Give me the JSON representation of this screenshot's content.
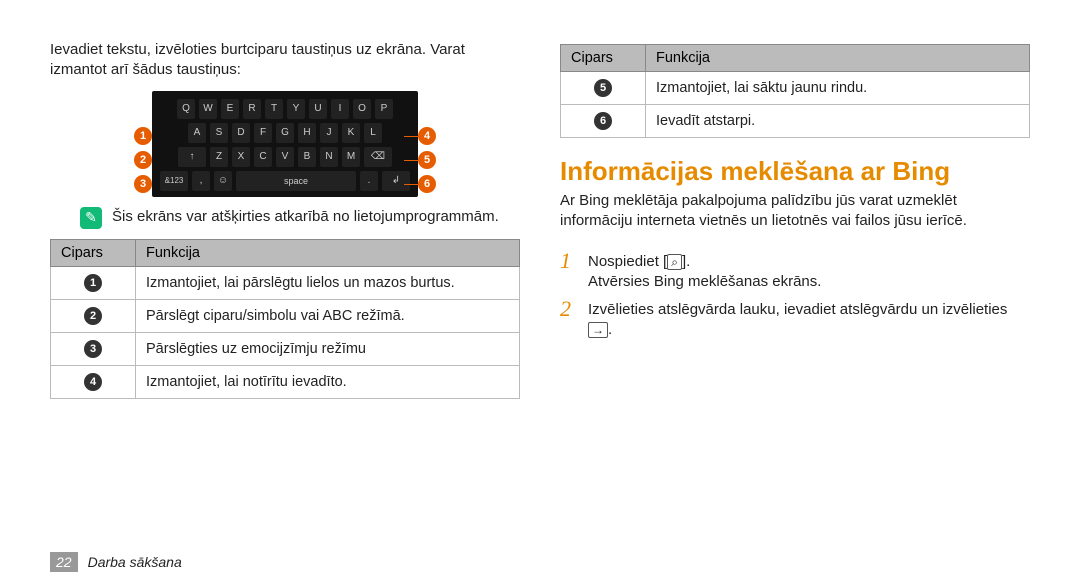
{
  "left": {
    "intro": "Ievadiet tekstu, izvēloties burtciparu taustiņus uz ekrāna. Varat izmantot arī šādus taustiņus:",
    "keyboard": {
      "row1": [
        "Q",
        "W",
        "E",
        "R",
        "T",
        "Y",
        "U",
        "I",
        "O",
        "P"
      ],
      "row2": [
        "A",
        "S",
        "D",
        "F",
        "G",
        "H",
        "J",
        "K",
        "L"
      ],
      "row3_shift": "↑",
      "row3": [
        "Z",
        "X",
        "C",
        "V",
        "B",
        "N",
        "M"
      ],
      "row3_del": "⌫",
      "row4_num": "&123",
      "row4_comma": ",",
      "row4_emoji": "☺",
      "row4_space": "space",
      "row4_dot": ".",
      "row4_enter": "↲"
    },
    "markers_left": [
      "1",
      "2",
      "3"
    ],
    "markers_right": [
      "4",
      "5",
      "6"
    ],
    "note": "Šis ekrāns var atšķirties atkarībā no lietojumprogrammām.",
    "table": {
      "head_num": "Cipars",
      "head_func": "Funkcija",
      "rows": [
        {
          "n": "1",
          "t": "Izmantojiet, lai pārslēgtu lielos un mazos burtus."
        },
        {
          "n": "2",
          "t": "Pārslēgt ciparu/simbolu vai ABC režīmā."
        },
        {
          "n": "3",
          "t": "Pārslēgties uz emocijzīmju režīmu"
        },
        {
          "n": "4",
          "t": "Izmantojiet, lai notīrītu ievadīto."
        }
      ]
    }
  },
  "right": {
    "table": {
      "head_num": "Cipars",
      "head_func": "Funkcija",
      "rows": [
        {
          "n": "5",
          "t": "Izmantojiet, lai sāktu jaunu rindu."
        },
        {
          "n": "6",
          "t": "Ievadīt atstarpi."
        }
      ]
    },
    "heading": "Informācijas meklēšana ar Bing",
    "desc": "Ar Bing meklētāja pakalpojuma palīdzību jūs varat uzmeklēt informāciju interneta vietnēs un lietotnēs vai failos jūsu ierīcē.",
    "steps": [
      {
        "n": "1",
        "pre": "Nospiediet [",
        "icon": "⌕",
        "post": "].",
        "after": "Atvērsies Bing meklēšanas ekrāns."
      },
      {
        "n": "2",
        "pre": "Izvēlieties atslēgvārda lauku, ievadiet atslēgvārdu un izvēlieties ",
        "icon": "→",
        "post": ".",
        "after": ""
      }
    ]
  },
  "footer": {
    "page": "22",
    "section": "Darba sākšana"
  }
}
